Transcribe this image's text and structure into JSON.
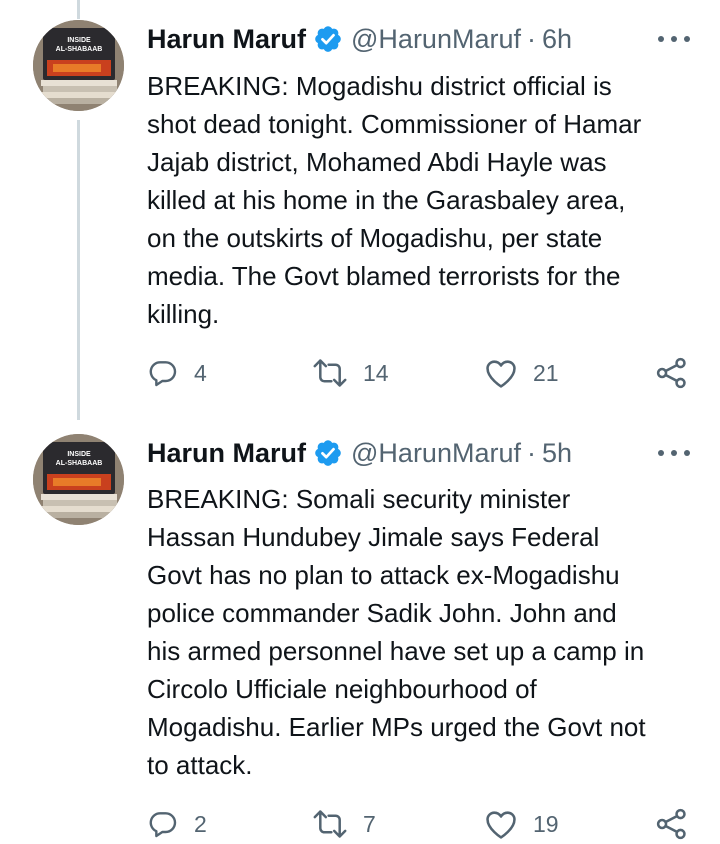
{
  "tweets": [
    {
      "author": {
        "name": "Harun Maruf",
        "handle": "@HarunMaruf",
        "avatar_book_title": [
          "INSIDE",
          "AL-SHABAAB"
        ],
        "verified": true
      },
      "separator": "·",
      "time": "6h",
      "more_icon": "more-horizontal-icon",
      "text_lines": [
        "BREAKING: Mogadishu district official is",
        "shot dead tonight. Commissioner of Hamar",
        "Jajab district, Mohamed Abdi Hayle was",
        "killed at his home in the Garasbaley area,",
        "on the outskirts of Mogadishu, per state",
        "media. The Govt blamed terrorists for the",
        "killing."
      ],
      "actions": {
        "replies": "4",
        "retweets": "14",
        "likes": "21"
      }
    },
    {
      "author": {
        "name": "Harun Maruf",
        "handle": "@HarunMaruf",
        "avatar_book_title": [
          "INSIDE",
          "AL-SHABAAB"
        ],
        "verified": true
      },
      "separator": "·",
      "time": "5h",
      "more_icon": "more-horizontal-icon",
      "text_lines": [
        "BREAKING: Somali security minister",
        "Hassan Hundubey Jimale says Federal",
        "Govt has no plan to attack ex-Mogadishu",
        "police commander Sadik John. John and",
        "his armed personnel have set up a camp in",
        "Circolo Ufficiale neighbourhood of",
        "Mogadishu. Earlier MPs urged the Govt not",
        "to attack."
      ],
      "actions": {
        "replies": "2",
        "retweets": "7",
        "likes": "19"
      }
    }
  ],
  "colors": {
    "text": "#0f1419",
    "secondary": "#536471",
    "verified": "#1d9bf0",
    "thread_line": "#cfd9de"
  },
  "icons": {
    "reply": "reply-icon",
    "retweet": "retweet-icon",
    "like": "heart-icon",
    "share": "share-icon",
    "verified": "verified-badge-icon"
  }
}
